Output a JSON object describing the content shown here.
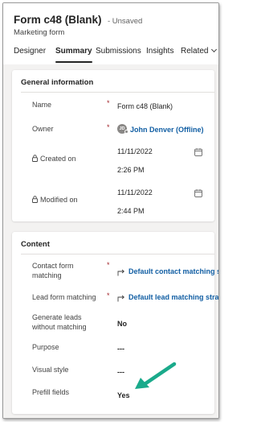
{
  "header": {
    "title": "Form c48 (Blank)",
    "unsaved": "- Unsaved",
    "subtitle": "Marketing form"
  },
  "tabs": [
    {
      "label": "Designer"
    },
    {
      "label": "Summary",
      "active": true
    },
    {
      "label": "Submissions"
    },
    {
      "label": "Insights"
    },
    {
      "label": "Related"
    }
  ],
  "general": {
    "title": "General information",
    "name_label": "Name",
    "name_value": "Form c48 (Blank)",
    "owner_label": "Owner",
    "owner_initials": "JD",
    "owner_value": "John Denver (Offline)",
    "created_label": "Created on",
    "created_date": "11/11/2022",
    "created_time": "2:26 PM",
    "modified_label": "Modified on",
    "modified_date": "11/11/2022",
    "modified_time": "2:44 PM"
  },
  "content": {
    "title": "Content",
    "contact_matching_label": "Contact form matching",
    "contact_matching_value": "Default contact matching st...",
    "lead_matching_label": "Lead form matching",
    "lead_matching_value": "Default lead matching strat...",
    "generate_leads_label": "Generate leads without matching",
    "generate_leads_value": "No",
    "purpose_label": "Purpose",
    "purpose_value": "---",
    "visual_style_label": "Visual style",
    "visual_style_value": "---",
    "prefill_label": "Prefill fields",
    "prefill_value": "Yes"
  },
  "required_marker": "*",
  "colors": {
    "annotation_arrow": "#1aaa8b",
    "link": "#115ea3",
    "required": "#a4262c"
  }
}
